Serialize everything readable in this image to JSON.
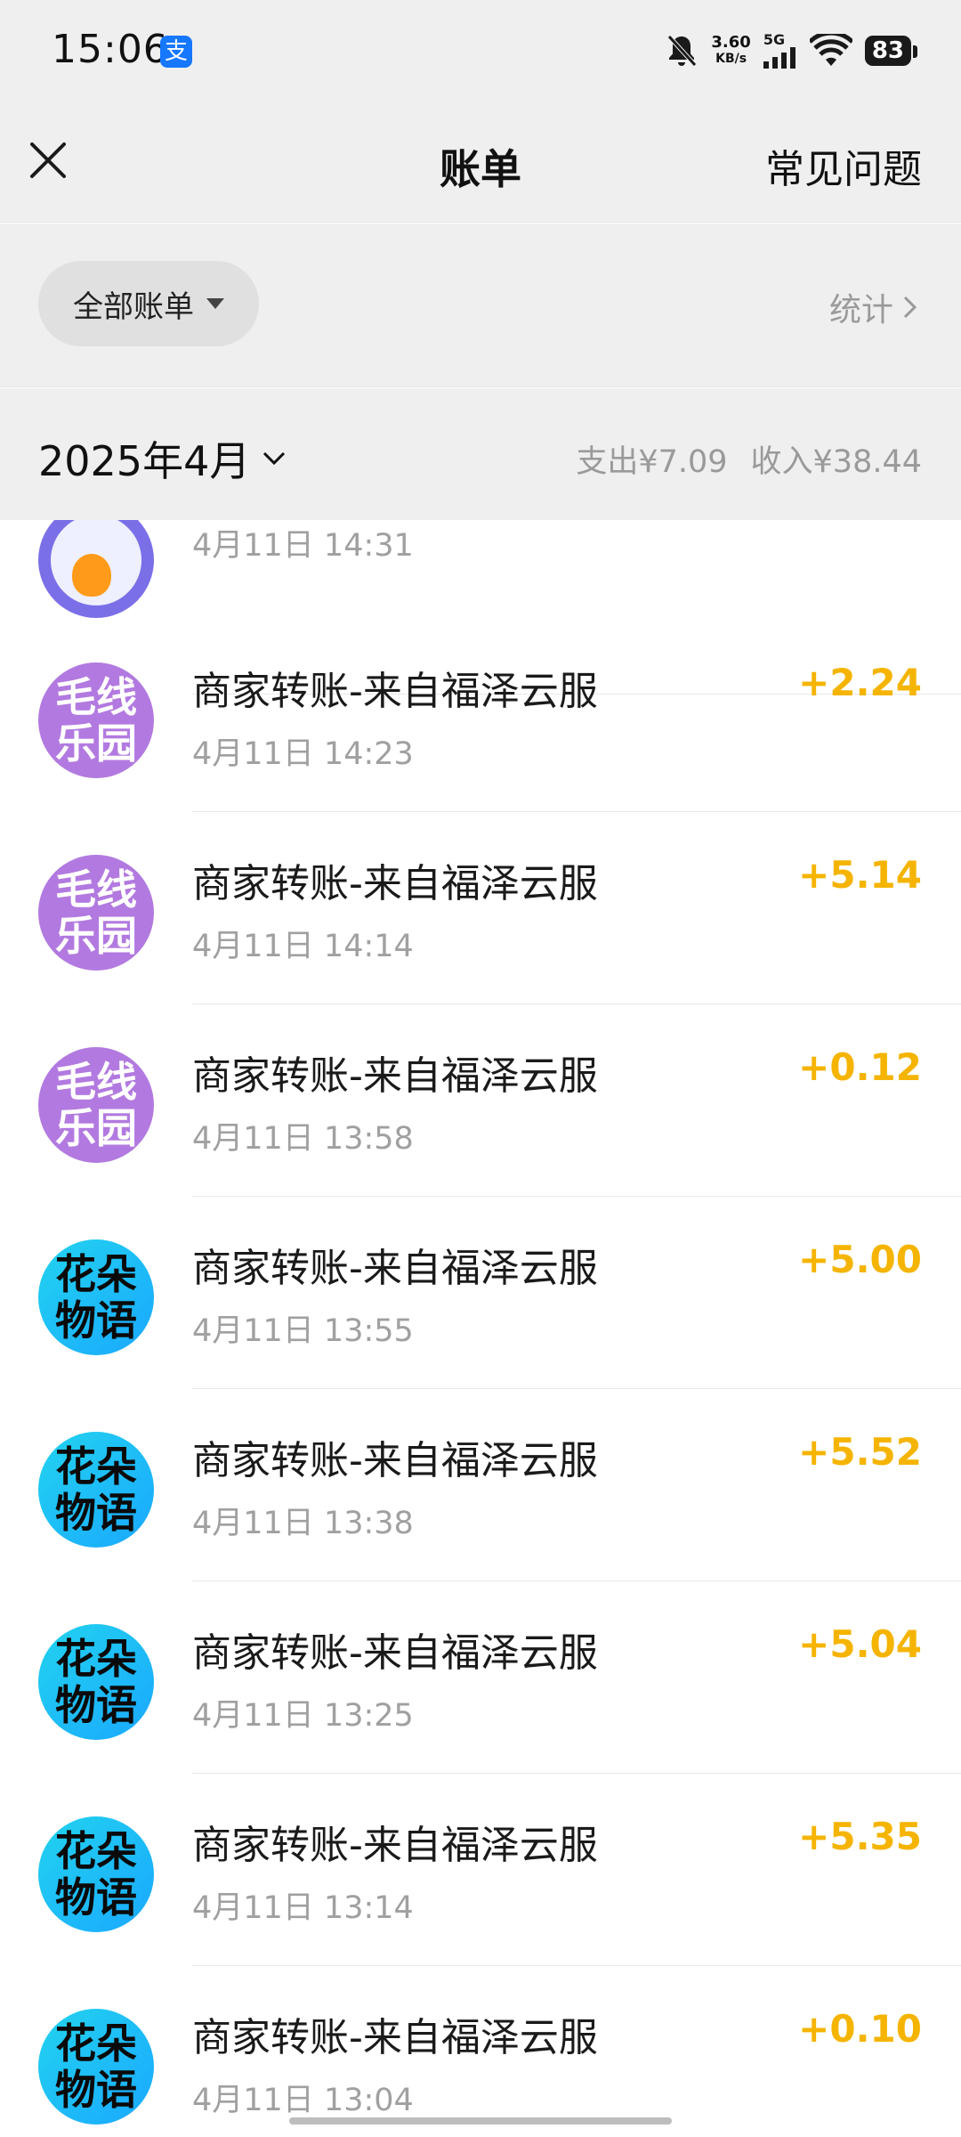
{
  "status": {
    "time": "15:06",
    "alipay_badge": "支",
    "speed_value": "3.60",
    "speed_unit": "KB/s",
    "network": "5G",
    "battery": "83"
  },
  "nav": {
    "title": "账单",
    "faq": "常见问题"
  },
  "filter": {
    "all_bills": "全部账单",
    "stats": "统计"
  },
  "month": {
    "label": "2025年4月",
    "expense": "支出¥7.09",
    "income": "收入¥38.44"
  },
  "partial_row": {
    "time": "4月11日 14:31"
  },
  "rows": [
    {
      "avatar": "毛线乐园",
      "avatar_style": "purple",
      "title": "商家转账-来自福泽云服",
      "time": "4月11日 14:23",
      "amount": "+2.24"
    },
    {
      "avatar": "毛线乐园",
      "avatar_style": "purple",
      "title": "商家转账-来自福泽云服",
      "time": "4月11日 14:14",
      "amount": "+5.14"
    },
    {
      "avatar": "毛线乐园",
      "avatar_style": "purple",
      "title": "商家转账-来自福泽云服",
      "time": "4月11日 13:58",
      "amount": "+0.12"
    },
    {
      "avatar": "花朵物语",
      "avatar_style": "blue",
      "title": "商家转账-来自福泽云服",
      "time": "4月11日 13:55",
      "amount": "+5.00"
    },
    {
      "avatar": "花朵物语",
      "avatar_style": "blue",
      "title": "商家转账-来自福泽云服",
      "time": "4月11日 13:38",
      "amount": "+5.52"
    },
    {
      "avatar": "花朵物语",
      "avatar_style": "blue",
      "title": "商家转账-来自福泽云服",
      "time": "4月11日 13:25",
      "amount": "+5.04"
    },
    {
      "avatar": "花朵物语",
      "avatar_style": "blue",
      "title": "商家转账-来自福泽云服",
      "time": "4月11日 13:14",
      "amount": "+5.35"
    },
    {
      "avatar": "花朵物语",
      "avatar_style": "blue",
      "title": "商家转账-来自福泽云服",
      "time": "4月11日 13:04",
      "amount": "+0.10"
    }
  ],
  "colors": {
    "income_amount": "#f5b400",
    "header_bg": "#efefef",
    "purple_avatar": "#b27ae0",
    "blue_avatar": "#22d3ee"
  }
}
